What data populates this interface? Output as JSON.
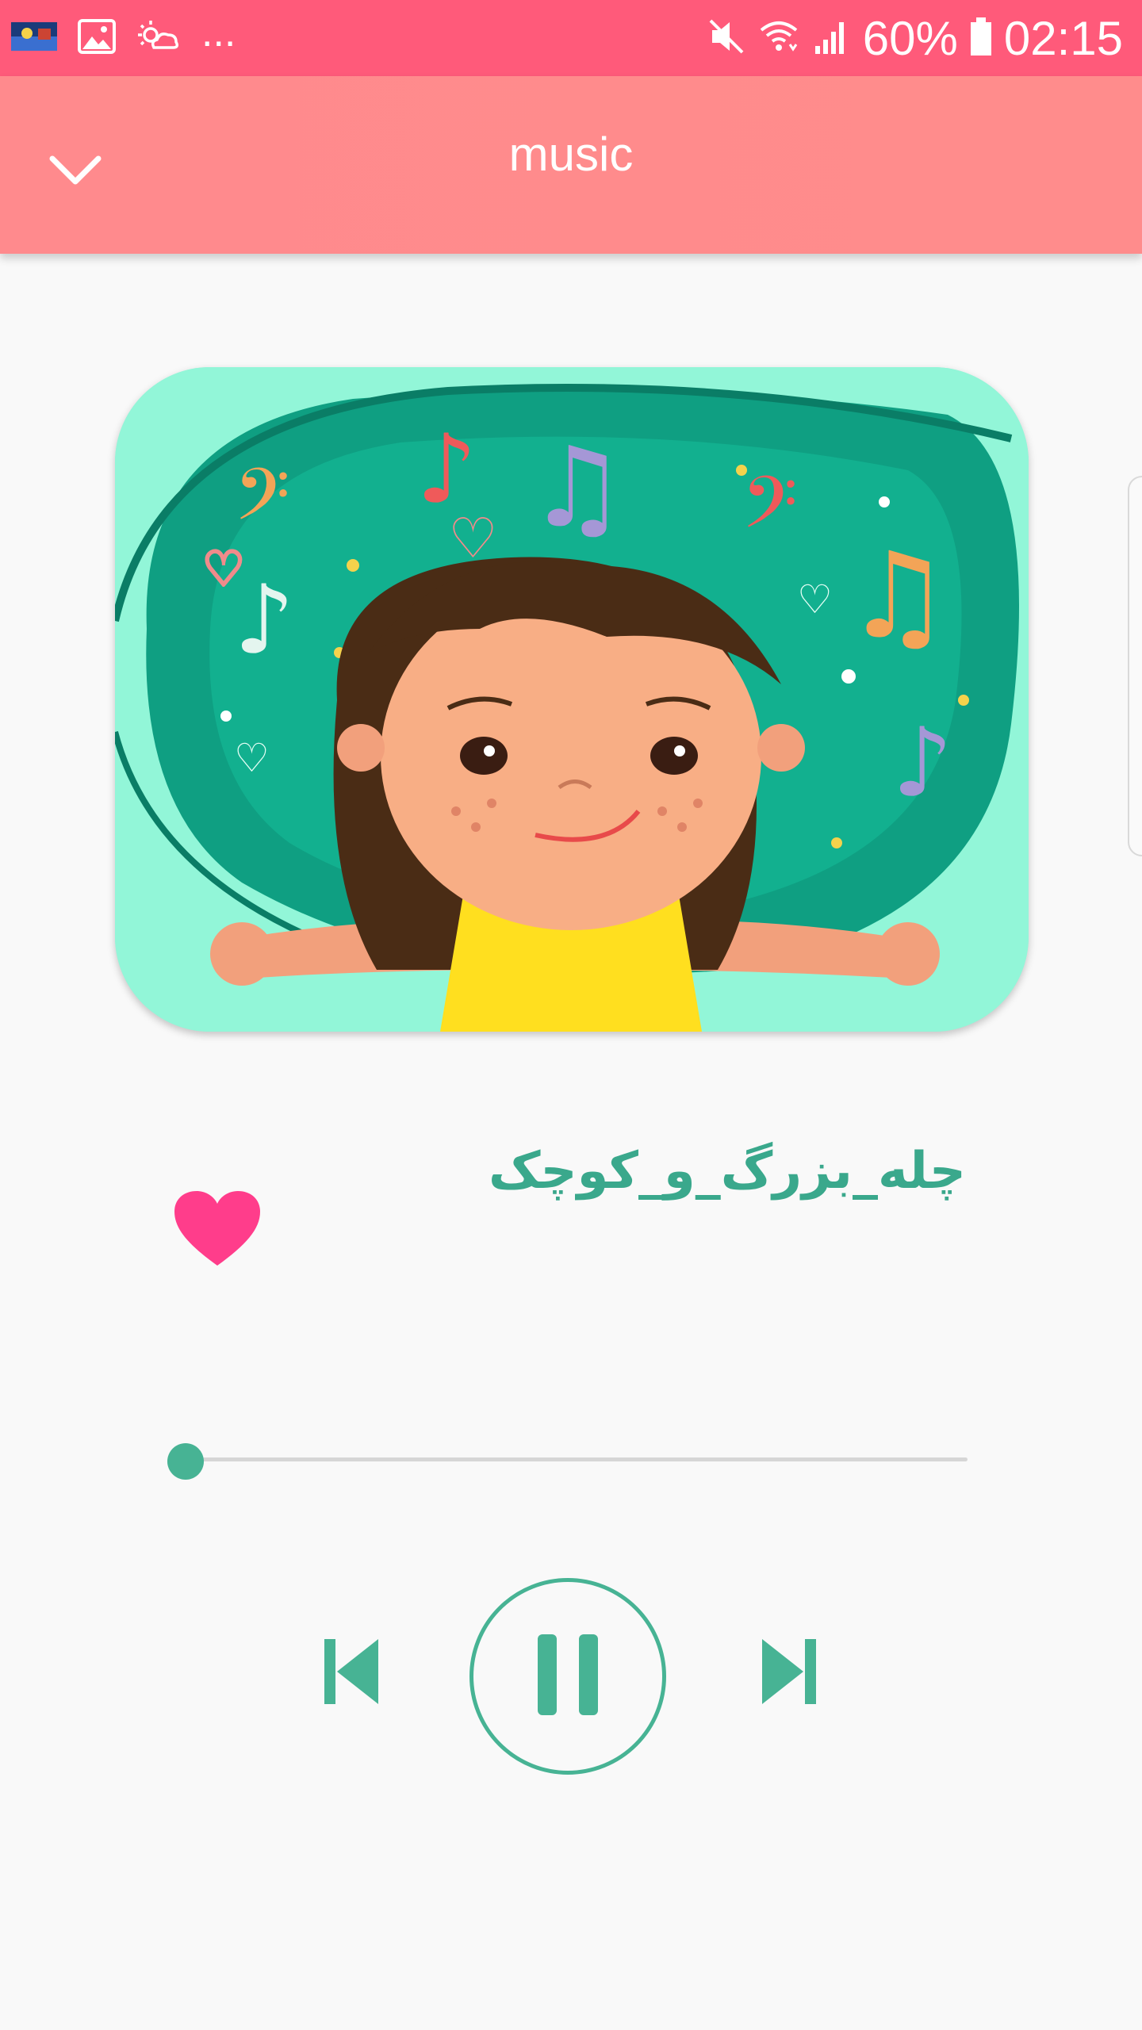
{
  "status_bar": {
    "battery": "60%",
    "time": "02:15",
    "overflow": "...",
    "icons": [
      "thumbnail-icon",
      "gallery-icon",
      "weather-icon",
      "mute-icon",
      "wifi-icon",
      "signal-icon",
      "battery-icon"
    ]
  },
  "app_bar": {
    "title": "music",
    "back_icon": "chevron-down-icon"
  },
  "player": {
    "song_title": "چله_بزرگ_و_کوچک",
    "liked": true,
    "progress": 0.0,
    "state": "playing"
  },
  "controls": {
    "icons": [
      "skip-previous-icon",
      "pause-icon",
      "skip-next-icon"
    ]
  },
  "colors": {
    "status_bar": "#ff5a7a",
    "app_bar": "#ff8a8d",
    "accent": "#47b394",
    "heart": "#ff3d8b",
    "title_text": "#3aa88c",
    "artwork_bg": "#92f6d8"
  }
}
